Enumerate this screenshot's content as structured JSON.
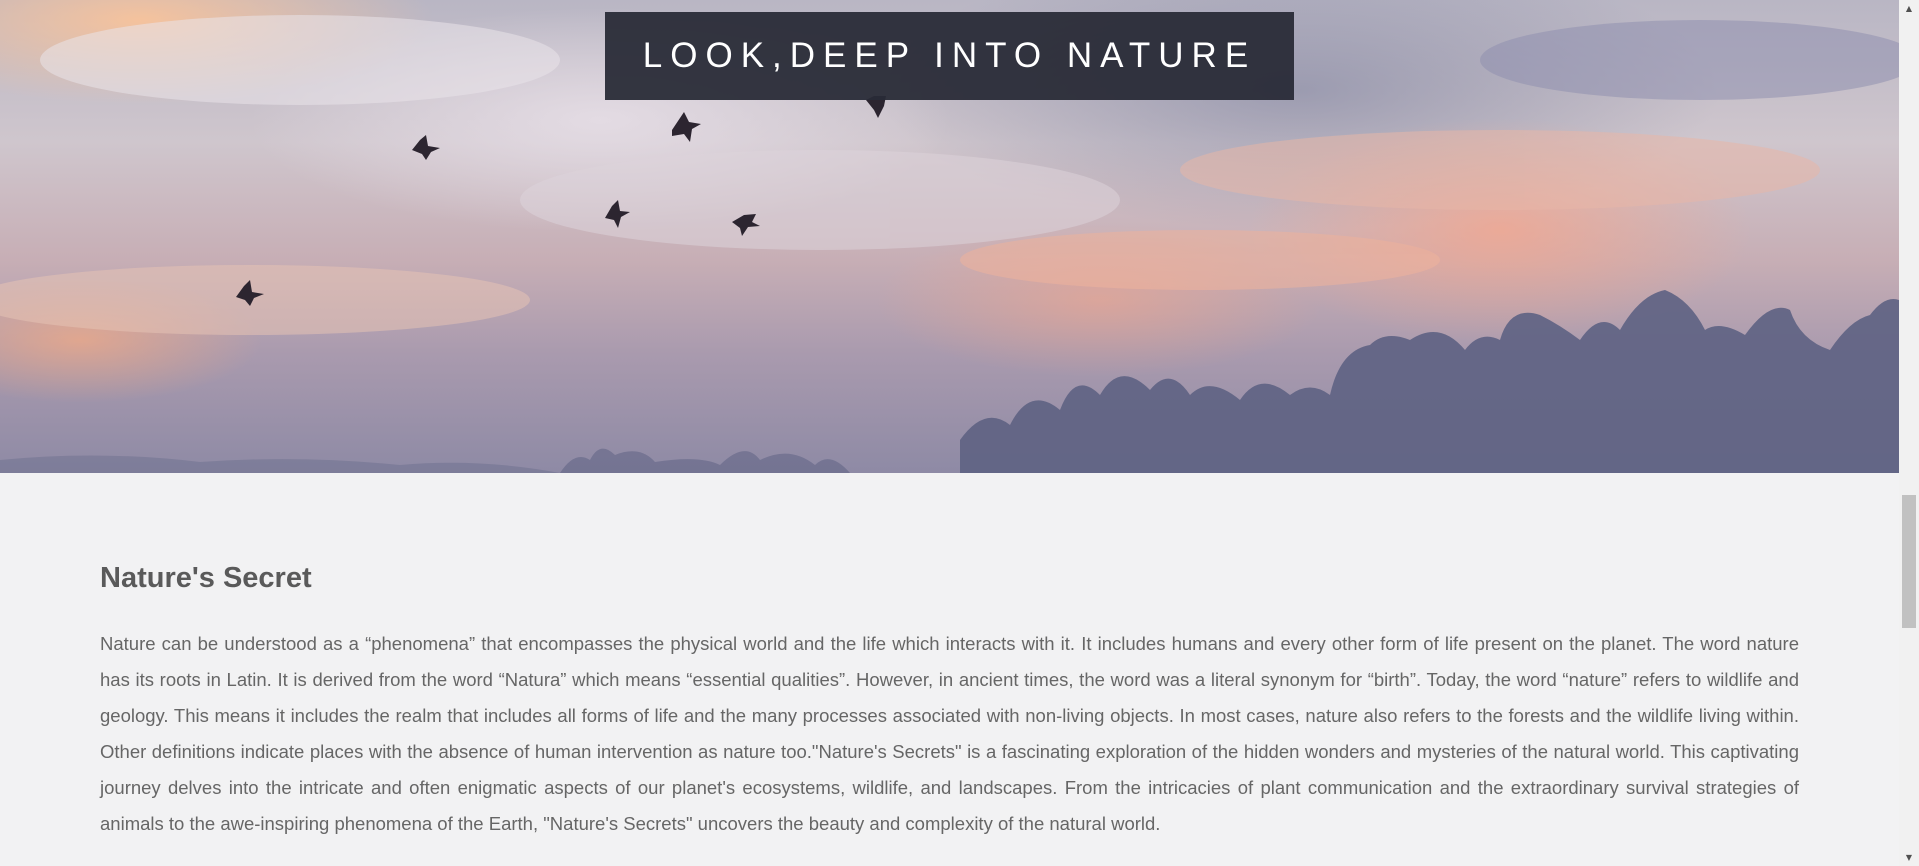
{
  "hero": {
    "title": "LOOK,DEEP INTO NATURE",
    "image_description": "sunset-sky-with-birds-and-misty-trees"
  },
  "section": {
    "title": "Nature's Secret",
    "body": "Nature can be understood as a “phenomena” that encompasses the physical world and the life which interacts with it. It includes humans and every other form of life present on the planet. The word nature has its roots in Latin. It is derived from the word “Natura” which means “essential qualities”. However, in ancient times, the word was a literal synonym for “birth”. Today, the word “nature” refers to wildlife and geology. This means it includes the realm that includes all forms of life and the many processes associated with non-living objects. In most cases, nature also refers to the forests and the wildlife living within. Other definitions indicate places with the absence of human intervention as nature too.\"Nature's Secrets\" is a fascinating exploration of the hidden wonders and mysteries of the natural world. This captivating journey delves into the intricate and often enigmatic aspects of our planet's ecosystems, wildlife, and landscapes. From the intricacies of plant communication and the extraordinary survival strategies of animals to the awe-inspiring phenomena of the Earth, \"Nature's Secrets\" uncovers the beauty and complexity of the natural world."
  },
  "colors": {
    "title_box_bg": "#282a36",
    "title_text": "#ffffff",
    "heading_text": "#5a5a5a",
    "body_text": "#666666",
    "page_bg": "#f2f2f3"
  },
  "icons": {
    "scroll_up": "scroll-up-arrow-icon",
    "scroll_down": "scroll-down-arrow-icon"
  }
}
